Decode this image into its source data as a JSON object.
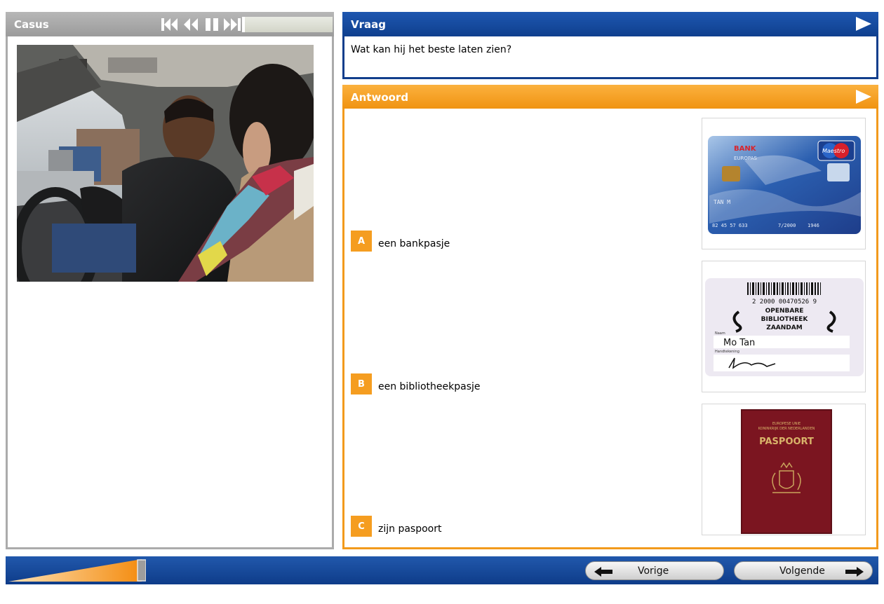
{
  "casus": {
    "title": "Casus"
  },
  "vraag": {
    "title": "Vraag",
    "question": "Wat kan hij het beste laten zien?"
  },
  "antwoord": {
    "title": "Antwoord",
    "options": [
      {
        "letter": "A",
        "text": "een bankpasje"
      },
      {
        "letter": "B",
        "text": "een bibliotheekpasje"
      },
      {
        "letter": "C",
        "text": "zijn paspoort"
      }
    ]
  },
  "bankcard": {
    "bank": "BANK",
    "sub": "EUROPAS",
    "brand": "Maestro",
    "name": "TAN M",
    "number": "82 45 57 633",
    "expiry": "7/2000",
    "code": "1946"
  },
  "librarycard": {
    "number": "2 2000 00470526 9",
    "line1": "OPENBARE",
    "line2": "BIBLIOTHEEK",
    "line3": "ZAANDAM",
    "name_label": "Naam",
    "name": "Mo Tan",
    "sign_label": "Handtekening"
  },
  "passport": {
    "top1": "EUROPESE UNIE",
    "top2": "KONINKRIJK DER NEDERLANDEN",
    "title": "PASPOORT"
  },
  "progress": {
    "value": 0.33
  },
  "nav": {
    "prev": "Vorige",
    "next": "Volgende"
  },
  "colors": {
    "blue": "#0f3f8e",
    "orange": "#f29a1c",
    "grey": "#ababab"
  }
}
